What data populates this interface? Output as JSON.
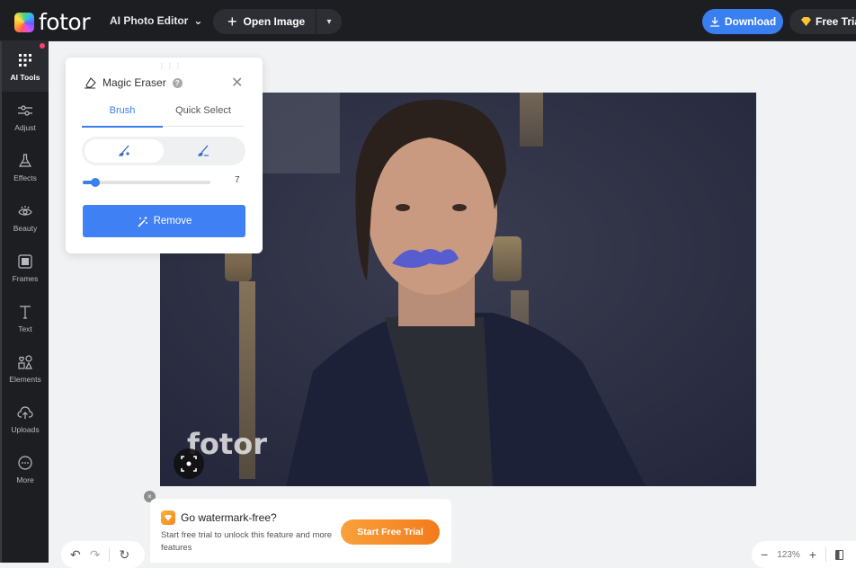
{
  "header": {
    "logo_text": "fotor",
    "app_menu_label": "AI Photo Editor",
    "open_image_label": "Open Image",
    "download_label": "Download",
    "free_trial_label": "Free Trial"
  },
  "sidebar": {
    "items": [
      {
        "label": "AI Tools",
        "icon": "grid-icon",
        "active": true
      },
      {
        "label": "Adjust",
        "icon": "sliders-icon"
      },
      {
        "label": "Effects",
        "icon": "flask-icon"
      },
      {
        "label": "Beauty",
        "icon": "eye-icon"
      },
      {
        "label": "Frames",
        "icon": "frame-icon"
      },
      {
        "label": "Text",
        "icon": "text-icon"
      },
      {
        "label": "Elements",
        "icon": "shapes-icon"
      },
      {
        "label": "Uploads",
        "icon": "cloud-upload-icon"
      },
      {
        "label": "More",
        "icon": "more-icon"
      }
    ]
  },
  "panel": {
    "title": "Magic Eraser",
    "help": "?",
    "tabs": [
      {
        "label": "Brush",
        "active": true
      },
      {
        "label": "Quick Select",
        "active": false
      }
    ],
    "brush_modes": [
      "brush-add",
      "brush-erase"
    ],
    "brush_size": "7",
    "brush_size_fraction": 0.1,
    "remove_label": "Remove"
  },
  "canvas": {
    "watermark": "fotor",
    "mask_color": "#4a55d6"
  },
  "promo": {
    "title": "Go watermark-free?",
    "description": "Start free trial to unlock this feature and more features",
    "button_label": "Start Free Trial",
    "close": "×"
  },
  "zoom": {
    "level": "123%",
    "minus": "−",
    "plus": "+"
  },
  "colors": {
    "accent": "#3a7ff0",
    "header_bg": "#1d1e22",
    "promo_orange": "#f27b1b"
  }
}
